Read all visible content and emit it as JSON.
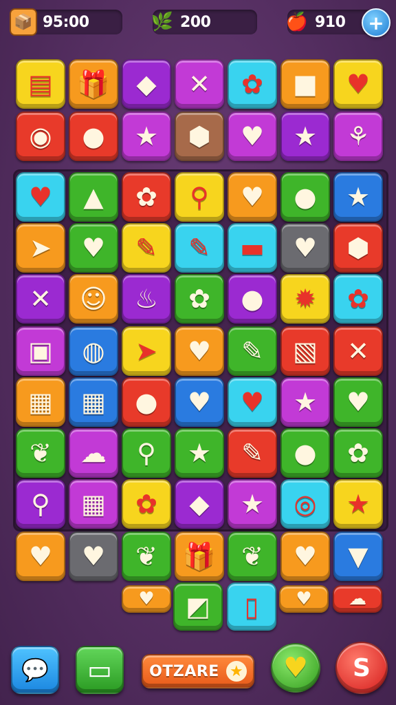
{
  "hud": {
    "left": {
      "icon": "box-icon",
      "glyph": "📦",
      "value": "95:00",
      "color": "#f7a23c"
    },
    "middle": {
      "icon": "leaf-icon",
      "glyph": "🌿",
      "value": "200",
      "color": "#4cc13d"
    },
    "right": {
      "icon": "apple-icon",
      "glyph": "🍎",
      "value": "910",
      "color": "#f39a1f"
    },
    "add_label": "+"
  },
  "colors": {
    "yellow": "#f7d51e",
    "orange": "#f79a1e",
    "purple": "#9b2ad1",
    "magenta": "#c23ad6",
    "cyan": "#39d3ef",
    "red": "#e83a2a",
    "blue": "#2a7be0",
    "green": "#3fb52a",
    "brown": "#a76a4a",
    "grey": "#6b6b70"
  },
  "tiles": [
    [
      [
        "yellow",
        "▤",
        "book-icon"
      ],
      [
        "orange",
        "🎁",
        "gift-icon"
      ],
      [
        "purple",
        "◆",
        "cake-icon"
      ],
      [
        "magenta",
        "✕",
        "x-mark-icon"
      ],
      [
        "cyan",
        "✿",
        "cookie-icon"
      ],
      [
        "orange",
        "■",
        "square-icon"
      ],
      [
        "yellow",
        "♥",
        "heart-icon"
      ]
    ],
    [
      [
        "red",
        "◉",
        "donut-icon"
      ],
      [
        "red",
        "●",
        "fish-icon"
      ],
      [
        "magenta",
        "★",
        "star-icon"
      ],
      [
        "brown",
        "⬢",
        "stone-icon"
      ],
      [
        "magenta",
        "♥",
        "heart-icon"
      ],
      [
        "purple",
        "★",
        "star-icon"
      ],
      [
        "magenta",
        "⚘",
        "leaf-icon"
      ]
    ],
    [
      [
        "cyan",
        "♥",
        "heart-icon"
      ],
      [
        "green",
        "▲",
        "triangle-icon"
      ],
      [
        "red",
        "✿",
        "flower-icon"
      ],
      [
        "yellow",
        "⚲",
        "lollipop-icon"
      ],
      [
        "orange",
        "♥",
        "heart-icon"
      ],
      [
        "green",
        "●",
        "berry-icon"
      ],
      [
        "blue",
        "★",
        "star-icon"
      ]
    ],
    [
      [
        "orange",
        "➤",
        "leaf-icon"
      ],
      [
        "green",
        "♥",
        "heart-icon"
      ],
      [
        "yellow",
        "✎",
        "pencil-icon"
      ],
      [
        "cyan",
        "✎",
        "crayon-icon"
      ],
      [
        "cyan",
        "▬",
        "capsule-icon"
      ],
      [
        "grey",
        "♥",
        "heart-icon"
      ],
      [
        "red",
        "⬢",
        "gem-icon"
      ]
    ],
    [
      [
        "purple",
        "✕",
        "sticks-icon"
      ],
      [
        "orange",
        "☺",
        "face-icon"
      ],
      [
        "purple",
        "♨",
        "cupcake-icon"
      ],
      [
        "green",
        "✿",
        "flower-face-icon"
      ],
      [
        "purple",
        "●",
        "apple-icon"
      ],
      [
        "yellow",
        "✹",
        "sun-icon"
      ],
      [
        "cyan",
        "✿",
        "shell-icon"
      ]
    ],
    [
      [
        "magenta",
        "▣",
        "robot-icon"
      ],
      [
        "blue",
        "◍",
        "orb-icon"
      ],
      [
        "yellow",
        "➤",
        "leaf-icon"
      ],
      [
        "orange",
        "♥",
        "heart-icon"
      ],
      [
        "green",
        "✎",
        "eraser-icon"
      ],
      [
        "red",
        "▧",
        "box-icon"
      ],
      [
        "red",
        "✕",
        "sticks-icon"
      ]
    ],
    [
      [
        "orange",
        "▦",
        "basket-icon"
      ],
      [
        "blue",
        "▦",
        "chocolate-icon"
      ],
      [
        "red",
        "●",
        "lemon-icon"
      ],
      [
        "blue",
        "♥",
        "heart-icon"
      ],
      [
        "cyan",
        "♥",
        "heart-icon"
      ],
      [
        "magenta",
        "★",
        "star-icon"
      ],
      [
        "green",
        "♥",
        "heart-icon"
      ]
    ],
    [
      [
        "green",
        "❦",
        "leaf-icon"
      ],
      [
        "magenta",
        "☁",
        "cloud-icon"
      ],
      [
        "green",
        "⚲",
        "lollipop-icon"
      ],
      [
        "green",
        "★",
        "star-icon"
      ],
      [
        "red",
        "✎",
        "pen-icon"
      ],
      [
        "green",
        "●",
        "apple-icon"
      ],
      [
        "green",
        "✿",
        "bug-icon"
      ]
    ],
    [
      [
        "purple",
        "⚲",
        "lollipop-icon"
      ],
      [
        "magenta",
        "▦",
        "waffle-icon"
      ],
      [
        "yellow",
        "✿",
        "flower-icon"
      ],
      [
        "purple",
        "◆",
        "cube-icon"
      ],
      [
        "magenta",
        "★",
        "star-icon"
      ],
      [
        "cyan",
        "◎",
        "ring-icon"
      ],
      [
        "yellow",
        "★",
        "star-icon"
      ]
    ],
    [
      [
        "orange",
        "♥",
        "heart-icon"
      ],
      [
        "grey",
        "♥",
        "heart-icon"
      ],
      [
        "green",
        "❦",
        "leaf-icon"
      ],
      [
        "orange",
        "🎁",
        "gift-icon"
      ],
      [
        "green",
        "❦",
        "leaf-icon"
      ],
      [
        "orange",
        "♥",
        "heart-icon"
      ],
      [
        "blue",
        "▼",
        "cup-icon"
      ]
    ]
  ],
  "bottom_row": [
    [
      "orange",
      "♥",
      "heart-icon"
    ],
    [
      "green",
      "◩",
      "square-icon"
    ],
    [
      "cyan",
      "▯",
      "bottle-icon"
    ],
    [
      "orange",
      "♥",
      "heart-icon"
    ],
    [
      "red",
      "☁",
      "cloud-icon"
    ]
  ],
  "footer": {
    "chat_icon": "💬",
    "message_icon": "▭",
    "pill_label": "OTZARE",
    "pill_star": "★",
    "heart_icon": "♥",
    "exit_icon": "S"
  }
}
